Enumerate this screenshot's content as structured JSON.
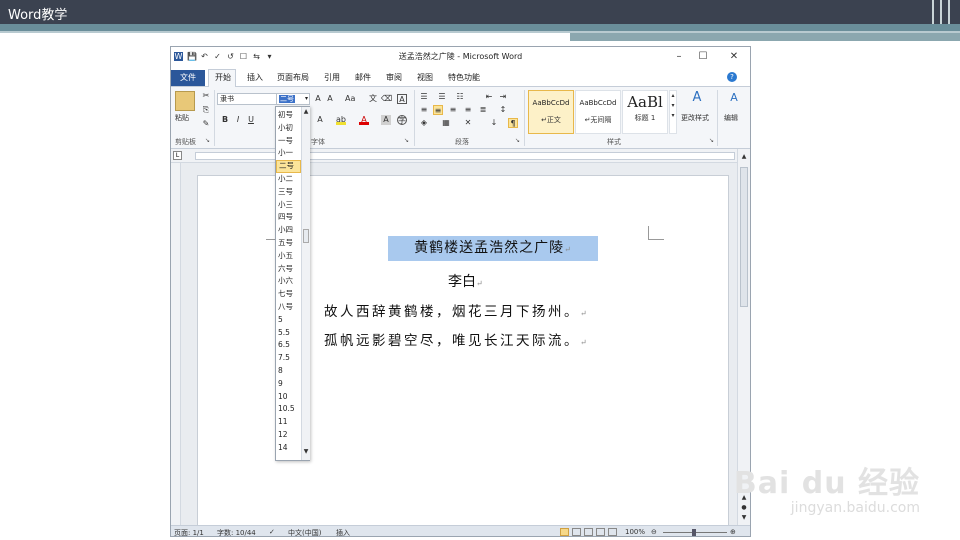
{
  "slide": {
    "title": "Word教学"
  },
  "window": {
    "title": "送孟浩然之广陵 - Microsoft Word",
    "qat": [
      "W",
      "💾",
      "↶",
      "✓",
      "↺",
      "☐",
      "⇆",
      "▾"
    ],
    "controls": {
      "minimize": "–",
      "restore": "☐",
      "close": "✕"
    }
  },
  "tabs": [
    "文件",
    "开始",
    "插入",
    "页面布局",
    "引用",
    "邮件",
    "审阅",
    "视图",
    "特色功能"
  ],
  "ribbon": {
    "clipboard": {
      "paste": "粘贴",
      "group": "剪贴板"
    },
    "font": {
      "name": "隶书",
      "size": "二号",
      "group": "字体"
    },
    "paragraph": {
      "group": "段落"
    },
    "styles": {
      "group": "样式",
      "items": [
        {
          "sample": "AaBbCcDd",
          "name": "↵正文"
        },
        {
          "sample": "AaBbCcDd",
          "name": "↵无间隔"
        },
        {
          "sample": "AaBl",
          "name": "标题 1"
        }
      ],
      "change": "更改样式"
    },
    "editing": {
      "label": "编辑"
    }
  },
  "font_size_options": [
    "初号",
    "小初",
    "一号",
    "小一",
    "二号",
    "小二",
    "三号",
    "小三",
    "四号",
    "小四",
    "五号",
    "小五",
    "六号",
    "小六",
    "七号",
    "八号",
    "5",
    "5.5",
    "6.5",
    "7.5",
    "8",
    "9",
    "10",
    "10.5",
    "11",
    "12",
    "14"
  ],
  "font_size_selected": "二号",
  "document": {
    "title": "黄鹤楼送孟浩然之广陵",
    "author": "李白",
    "lines": [
      "故人西辞黄鹤楼，烟花三月下扬州。",
      "孤帆远影碧空尽，唯见长江天际流。"
    ],
    "para_mark": "↵"
  },
  "status": {
    "page": "页面: 1/1",
    "words": "字数: 10/44",
    "lang": "中文(中国)",
    "mode": "插入",
    "zoom": "100%"
  },
  "watermark": {
    "brand": "Bai du 经验",
    "url": "jingyan.baidu.com"
  }
}
